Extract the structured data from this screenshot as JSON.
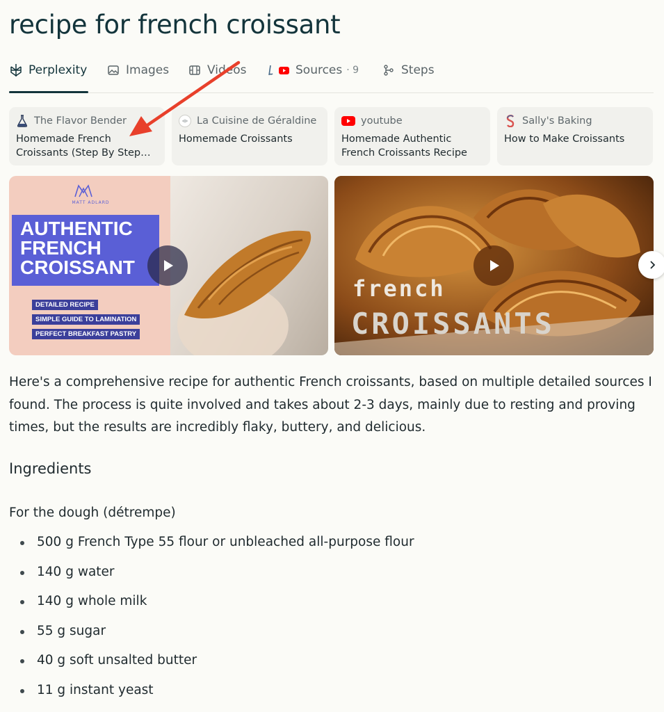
{
  "query_title": "recipe for french croissant",
  "tabs": [
    {
      "label": "Perplexity",
      "icon": "perplexity-icon"
    },
    {
      "label": "Images",
      "icon": "image-icon"
    },
    {
      "label": "Videos",
      "icon": "video-icon"
    },
    {
      "label": "Sources",
      "icon": "sources-icon",
      "count": "· 9"
    },
    {
      "label": "Steps",
      "icon": "steps-icon"
    }
  ],
  "sources": [
    {
      "site": "The Flavor Bender",
      "title": "Homemade French Croissants (Step By Step…",
      "favicon": "flask-favicon"
    },
    {
      "site": "La Cuisine de Géraldine",
      "title": "Homemade Croissants",
      "favicon": "geraldine-favicon"
    },
    {
      "site": "youtube",
      "title": "Homemade Authentic French Croissants Recipe",
      "favicon": "youtube-favicon"
    },
    {
      "site": "Sally's Baking",
      "title": "How to Make Croissants",
      "favicon": "sallys-favicon"
    }
  ],
  "videos": [
    {
      "brand": "MATT ADLARD",
      "title_lines": [
        "AUTHENTIC",
        "FRENCH",
        "CROISSANT"
      ],
      "tags": [
        "DETAILED RECIPE",
        "SIMPLE GUIDE TO LAMINATION",
        "PERFECT BREAKFAST PASTRY"
      ]
    },
    {
      "overlay_small": "french",
      "overlay_big": "CROISSANTS"
    }
  ],
  "answer": {
    "intro": "Here's a comprehensive recipe for authentic French croissants, based on multiple detailed sources I found. The process is quite involved and takes about 2-3 days, mainly due to resting and proving times, but the results are incredibly flaky, buttery, and delicious.",
    "ingredients_heading": "Ingredients",
    "dough_heading": "For the dough (détrempe)",
    "dough_items": [
      "500 g French Type 55 flour or unbleached all-purpose flour",
      "140 g water",
      "140 g whole milk",
      "55 g sugar",
      "40 g soft unsalted butter",
      "11 g instant yeast"
    ]
  },
  "colors": {
    "background": "#fbfbf7",
    "title": "#13343b",
    "card": "#f1f1ed",
    "annotation_arrow": "#e8402b",
    "youtube_red": "#ff0000",
    "video_banner": "#5a5fd6"
  }
}
